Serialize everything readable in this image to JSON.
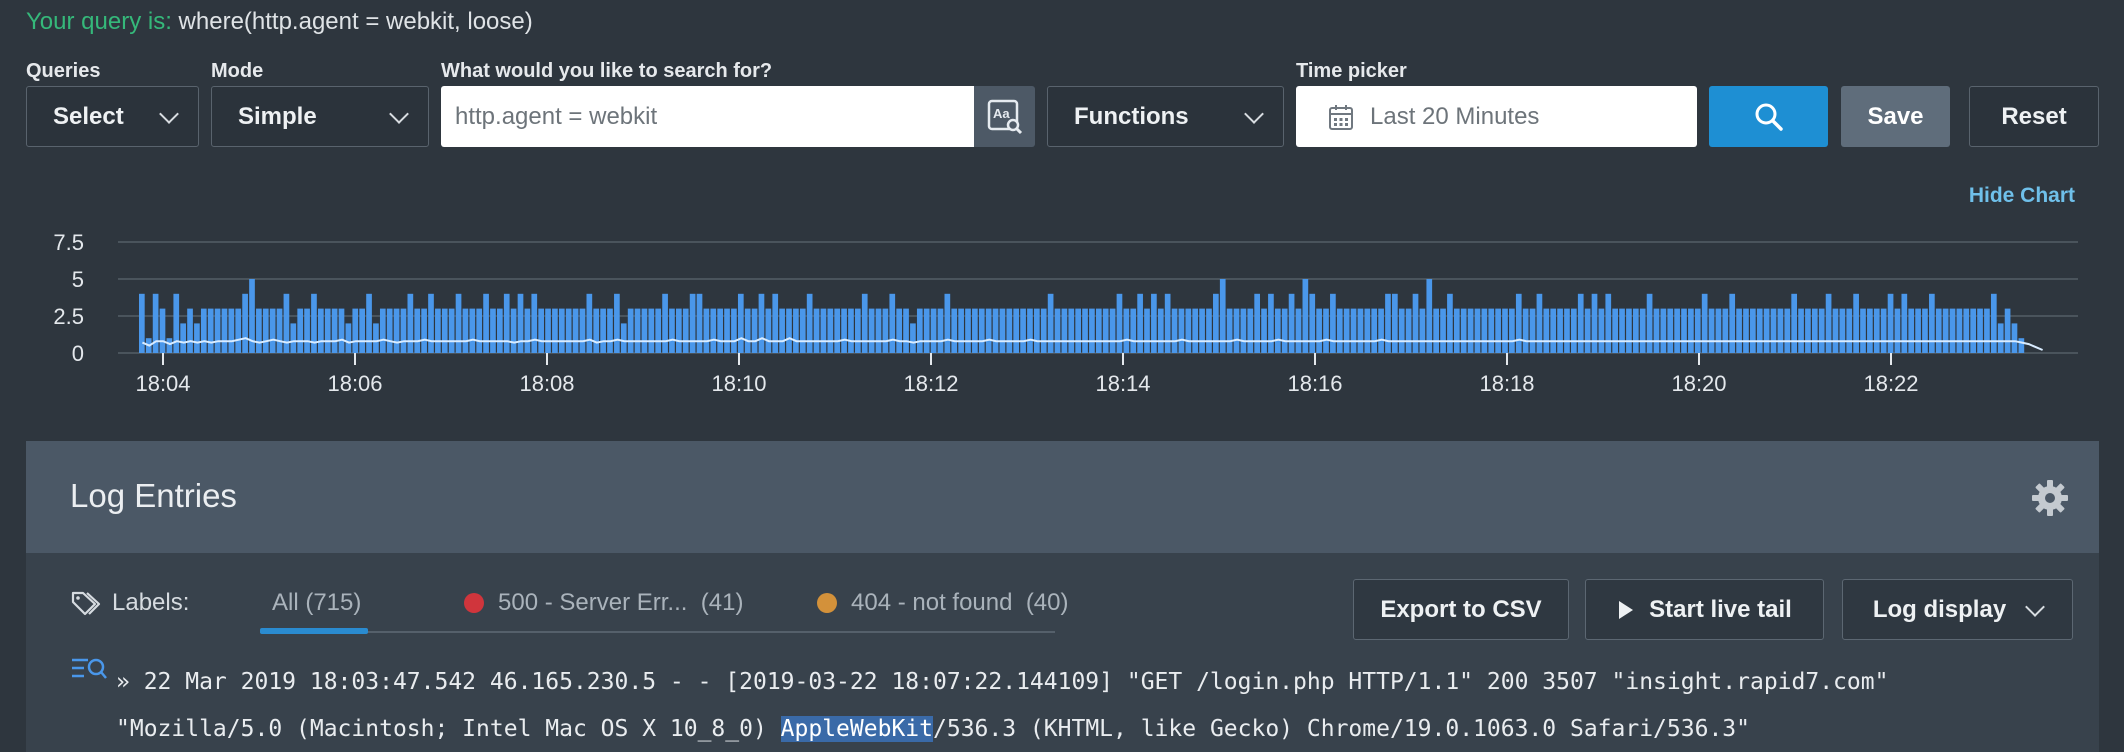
{
  "query": {
    "label": "Your query is:",
    "text": " where(http.agent = webkit, loose)"
  },
  "toolbar": {
    "queries_label": "Queries",
    "queries_value": "Select",
    "mode_label": "Mode",
    "mode_value": "Simple",
    "search_label": "What would you like to search for?",
    "search_value": "http.agent = webkit",
    "functions_value": "Functions",
    "time_label": "Time picker",
    "time_value": "Last 20 Minutes",
    "save_label": "Save",
    "reset_label": "Reset"
  },
  "hide_chart_label": "Hide Chart",
  "colors": {
    "bar": "#4a97ea",
    "line": "#d9ecff",
    "grid": "#67717b",
    "accent": "#1e8fd3"
  },
  "chart_data": {
    "type": "bar",
    "xlabel": "",
    "ylabel": "",
    "y_ticks": [
      "0",
      "2.5",
      "5",
      "7.5"
    ],
    "ylim": [
      0,
      7.5
    ],
    "x_ticks": [
      "18:04",
      "18:06",
      "18:08",
      "18:10",
      "18:12",
      "18:14",
      "18:16",
      "18:18",
      "18:20",
      "18:22"
    ],
    "x_start_minute": 3.75,
    "x_end_minute": 23.4,
    "values": [
      4,
      1,
      4,
      3,
      1,
      4,
      2,
      3,
      2,
      3,
      3,
      3,
      3,
      3,
      3,
      4,
      5,
      3,
      3,
      3,
      3,
      4,
      2,
      3,
      3,
      4,
      3,
      3,
      3,
      3,
      2,
      3,
      3,
      4,
      2,
      3,
      3,
      3,
      3,
      4,
      3,
      3,
      4,
      3,
      3,
      3,
      4,
      3,
      3,
      3,
      4,
      3,
      3,
      4,
      3,
      4,
      3,
      4,
      3,
      3,
      3,
      3,
      3,
      3,
      3,
      4,
      3,
      3,
      3,
      4,
      2,
      3,
      3,
      3,
      3,
      3,
      4,
      3,
      3,
      3,
      4,
      4,
      3,
      3,
      3,
      3,
      3,
      4,
      3,
      3,
      4,
      3,
      4,
      3,
      3,
      3,
      3,
      4,
      3,
      3,
      3,
      3,
      3,
      3,
      3,
      4,
      3,
      3,
      3,
      4,
      3,
      3,
      2,
      3,
      3,
      3,
      3,
      4,
      3,
      3,
      3,
      3,
      3,
      3,
      3,
      3,
      3,
      3,
      3,
      3,
      3,
      3,
      4,
      3,
      3,
      3,
      3,
      3,
      3,
      3,
      3,
      3,
      4,
      3,
      3,
      4,
      3,
      4,
      3,
      4,
      3,
      3,
      3,
      3,
      3,
      3,
      4,
      5,
      3,
      3,
      3,
      3,
      4,
      3,
      4,
      3,
      3,
      4,
      3,
      5,
      4,
      3,
      3,
      4,
      3,
      3,
      3,
      3,
      3,
      3,
      3,
      4,
      4,
      3,
      3,
      4,
      3,
      5,
      3,
      3,
      4,
      3,
      3,
      3,
      3,
      3,
      3,
      3,
      3,
      3,
      4,
      3,
      3,
      4,
      3,
      3,
      3,
      3,
      3,
      4,
      3,
      4,
      3,
      4,
      3,
      3,
      3,
      3,
      3,
      4,
      3,
      3,
      3,
      3,
      3,
      3,
      3,
      4,
      3,
      3,
      3,
      4,
      3,
      3,
      3,
      3,
      3,
      3,
      3,
      3,
      4,
      3,
      3,
      3,
      3,
      4,
      3,
      3,
      3,
      4,
      3,
      3,
      3,
      3,
      4,
      3,
      4,
      3,
      3,
      3,
      4,
      3,
      3,
      3,
      3,
      3,
      3,
      3,
      3,
      4,
      2,
      3,
      2,
      1
    ],
    "line": [
      0.7,
      0.5,
      0.8,
      0.8,
      0.6,
      0.8,
      0.7,
      0.8,
      0.7,
      0.8,
      0.7,
      0.8,
      0.8,
      0.8,
      0.9,
      1.0,
      0.8,
      0.7,
      0.8,
      0.9,
      0.8,
      0.7,
      0.8,
      0.8,
      0.8,
      0.7,
      0.8,
      0.8,
      0.8,
      0.9,
      0.7,
      0.8,
      0.8,
      0.8,
      0.8,
      0.9,
      0.8,
      0.7,
      0.8,
      0.8,
      0.8,
      0.9,
      0.8,
      0.8,
      0.8,
      0.8,
      0.8,
      0.8,
      0.9,
      0.8,
      0.8,
      0.8,
      0.8,
      0.8,
      0.7,
      0.8,
      0.8,
      0.9,
      0.8,
      0.8,
      0.8,
      0.8,
      0.8,
      0.8,
      0.8,
      0.9,
      0.7,
      0.8,
      0.8,
      0.9,
      0.8,
      0.8,
      0.8,
      0.8,
      0.8,
      0.8,
      0.8,
      0.9,
      0.8,
      0.8,
      0.8,
      0.8,
      0.8,
      0.9,
      0.8,
      0.8,
      0.8,
      1.0,
      0.8,
      0.8,
      1.0,
      0.8,
      0.8,
      0.8,
      1.0,
      0.8,
      0.8,
      0.8,
      0.8,
      0.8,
      0.8,
      0.8,
      0.9,
      0.8,
      0.8,
      0.8,
      0.8,
      0.8,
      0.8,
      0.9,
      0.8,
      0.8,
      0.7,
      0.8,
      0.8,
      0.8,
      0.8,
      0.9,
      0.8,
      0.8,
      0.8,
      0.8,
      0.8,
      0.9,
      0.8,
      0.8,
      0.8,
      0.8,
      0.8,
      0.9,
      0.8,
      0.8,
      0.8,
      0.8,
      0.8,
      0.8,
      0.8,
      0.8,
      0.8,
      0.8,
      0.8,
      0.8,
      0.8,
      0.9,
      0.8,
      0.8,
      0.8,
      0.8,
      0.8,
      0.8,
      0.8,
      0.9,
      0.8,
      0.8,
      0.8,
      0.8,
      0.8,
      0.8,
      0.8,
      0.9,
      0.8,
      0.8,
      0.8,
      0.8,
      0.8,
      0.9,
      0.8,
      0.8,
      0.8,
      0.8,
      0.8,
      0.8,
      0.9,
      0.8,
      0.8,
      0.8,
      0.8,
      0.8,
      0.8,
      0.8,
      0.9,
      0.8,
      0.8,
      0.8,
      0.8,
      0.8,
      0.8,
      0.8,
      0.8,
      0.8,
      0.8,
      0.8,
      0.8,
      0.8,
      0.8,
      0.8,
      0.8,
      0.8,
      0.8,
      0.8,
      0.9,
      0.8,
      0.8,
      0.8,
      0.8,
      0.8,
      0.8,
      0.8,
      0.8,
      0.8,
      0.8,
      0.8,
      0.8,
      0.8,
      0.8,
      0.8,
      0.8,
      0.8,
      0.8,
      0.8,
      0.8,
      0.8,
      0.8,
      0.8,
      0.8,
      0.8,
      0.8,
      0.8,
      0.8,
      0.8,
      0.8,
      0.8,
      0.8,
      0.8,
      0.8,
      0.8,
      0.8,
      0.8,
      0.8,
      0.8,
      0.8,
      0.8,
      0.8,
      0.8,
      0.8,
      0.8,
      0.8,
      0.8,
      0.8,
      0.8,
      0.8,
      0.8,
      0.8,
      0.8,
      0.8,
      0.8,
      0.8,
      0.8,
      0.8,
      0.8,
      0.8,
      0.8,
      0.8,
      0.8,
      0.8,
      0.8,
      0.8,
      0.8,
      0.8,
      0.8,
      0.8,
      0.8,
      0.8,
      0.7,
      0.6,
      0.4,
      0.2
    ]
  },
  "log": {
    "title": "Log Entries",
    "labels_label": "Labels:",
    "tabs": [
      {
        "label": "All",
        "count": "(715)"
      },
      {
        "label": "500 - Server Err...",
        "count": "(41)",
        "color": "#d0353c"
      },
      {
        "label": "404 - not found",
        "count": "(40)",
        "color": "#d3913a"
      }
    ],
    "export_label": "Export to CSV",
    "live_tail_label": "Start live tail",
    "display_label": "Log display",
    "entry": {
      "prefix": "» 22 Mar 2019 18:03:47.542",
      "line1_rest": " 46.165.230.5 - - [2019-03-22 18:07:22.144109] \"GET /login.php HTTP/1.1\" 200 3507 \"insight.rapid7.com\"",
      "line2_pre": "\"Mozilla/5.0 (Macintosh; Intel Mac OS X 10_8_0) ",
      "line2_hl": "AppleWebKit",
      "line2_post": "/536.3 (KHTML, like Gecko) Chrome/19.0.1063.0 Safari/536.3\""
    }
  }
}
